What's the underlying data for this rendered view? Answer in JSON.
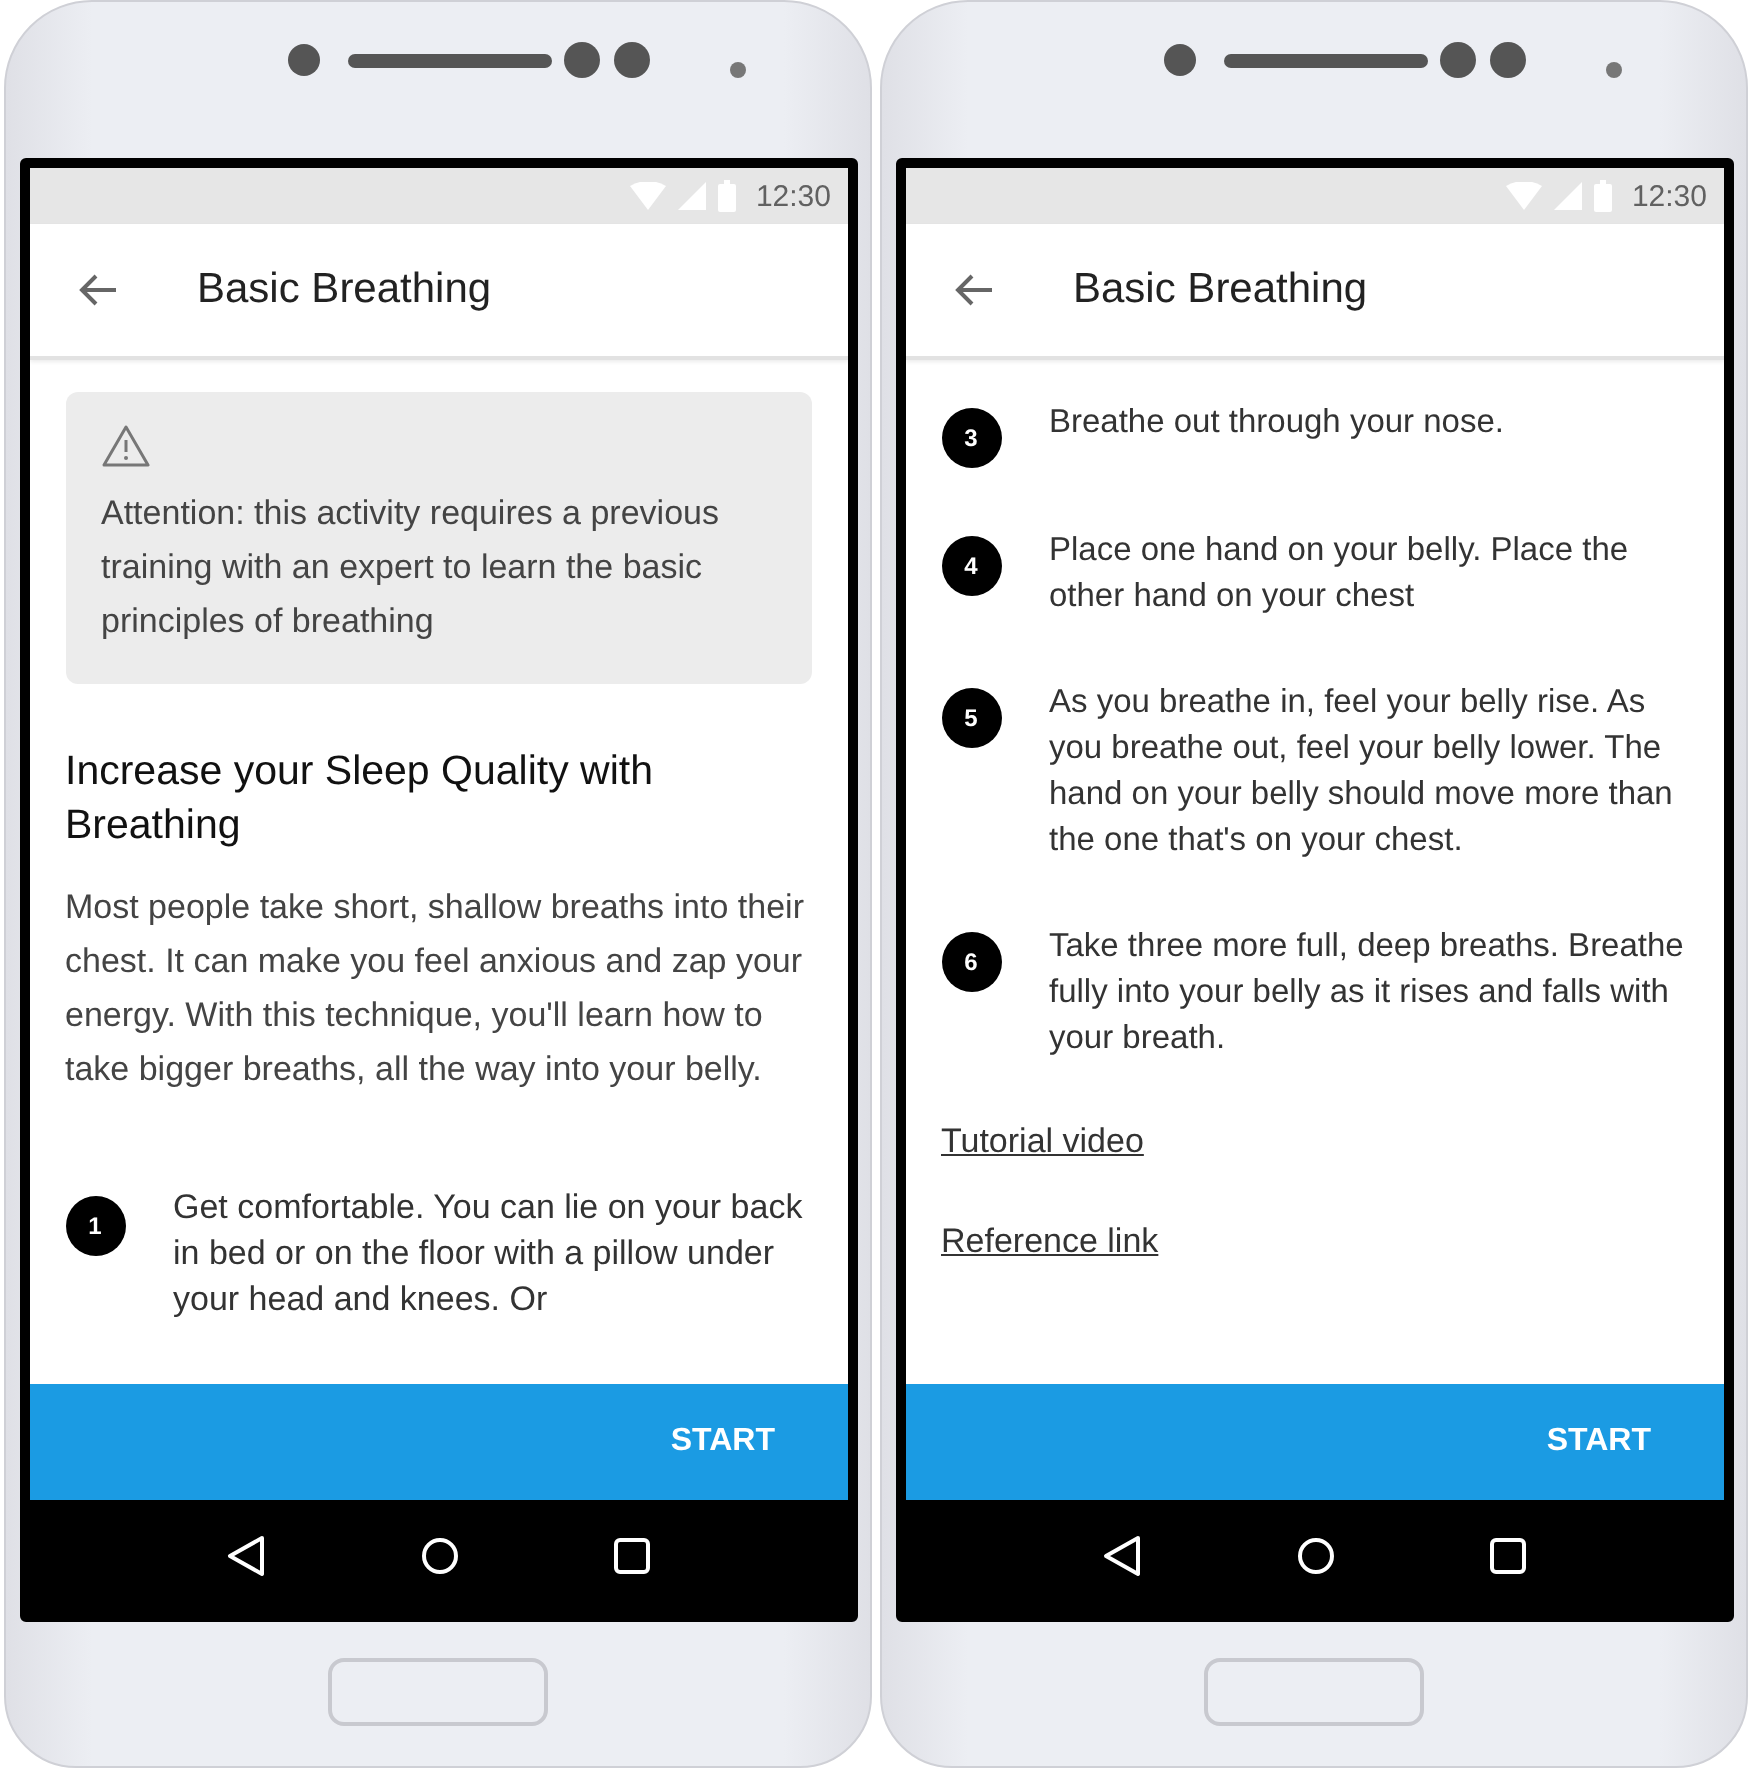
{
  "phones": [
    {
      "status_time": "12:30",
      "title": "Basic Breathing",
      "content": [
        {
          "kind": "alert",
          "text": "Attention: this activity requires a previous training with an expert to learn the basic principles of breathing"
        },
        {
          "kind": "heading",
          "text": "Increase your Sleep Quality with Breathing"
        },
        {
          "kind": "paragraph",
          "text": "Most people take short, shallow breaths into their chest. It can make you feel anxious and zap your energy. With this technique, you'll learn how to take bigger breaths, all the way into your belly."
        },
        {
          "kind": "step",
          "number": "1",
          "text": "Get comfortable. You can lie on your back in bed or on the floor with a pillow under your head and knees. Or"
        }
      ],
      "action": "START"
    },
    {
      "status_time": "12:30",
      "title": "Basic Breathing",
      "content": [
        {
          "kind": "step",
          "number": "3",
          "text": "Breathe out through your nose."
        },
        {
          "kind": "step",
          "number": "4",
          "text": "Place one hand on your belly. Place the other hand on your chest"
        },
        {
          "kind": "step",
          "number": "5",
          "text": "As you breathe in, feel your belly rise. As you breathe out, feel your belly lower. The hand on your belly should move more than the one that's on your chest."
        },
        {
          "kind": "step",
          "number": "6",
          "text": "Take three more full, deep breaths. Breathe fully into your belly as it rises and falls with your breath."
        },
        {
          "kind": "link",
          "text": "Tutorial video"
        },
        {
          "kind": "link",
          "text": "Reference link"
        }
      ],
      "action": "START"
    }
  ]
}
